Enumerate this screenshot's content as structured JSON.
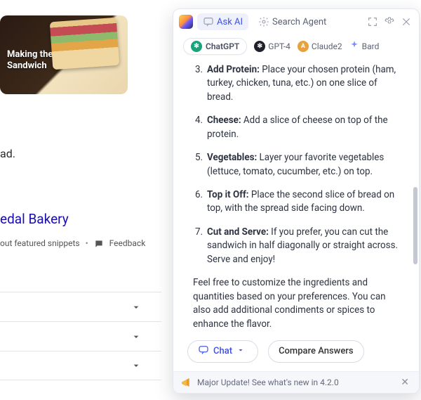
{
  "left": {
    "card_heading": "Making the\nSandwich",
    "snippet_tail": "ad.",
    "link": "edal Bakery",
    "featured": "out featured snippets",
    "feedback": "Feedback"
  },
  "header": {
    "ask_ai": "Ask AI",
    "search_agent": "Search Agent"
  },
  "models": {
    "chatgpt": "ChatGPT",
    "gpt4": "GPT-4",
    "claude2": "Claude2",
    "bard": "Bard"
  },
  "steps": [
    {
      "n": "3.",
      "title": "Add Protein:",
      "body": " Place your chosen protein (ham, turkey, chicken, tuna, etc.) on one slice of bread."
    },
    {
      "n": "4.",
      "title": "Cheese:",
      "body": " Add a slice of cheese on top of the protein."
    },
    {
      "n": "5.",
      "title": "Vegetables:",
      "body": " Layer your favorite vegetables (lettuce, tomato, cucumber, etc.) on top."
    },
    {
      "n": "6.",
      "title": "Top it Off:",
      "body": " Place the second slice of bread on top, with the spread side facing down."
    },
    {
      "n": "7.",
      "title": "Cut and Serve:",
      "body": " If you prefer, you can cut the sandwich in half diagonally or straight across. Serve and enjoy!"
    }
  ],
  "closing": "Feel free to customize the ingredients and quantities based on your preferences. You can also add additional condiments or spices to enhance the flavor.",
  "actions": {
    "chat": "Chat",
    "compare": "Compare Answers"
  },
  "banner": "Major Update! See what's new in 4.2.0"
}
